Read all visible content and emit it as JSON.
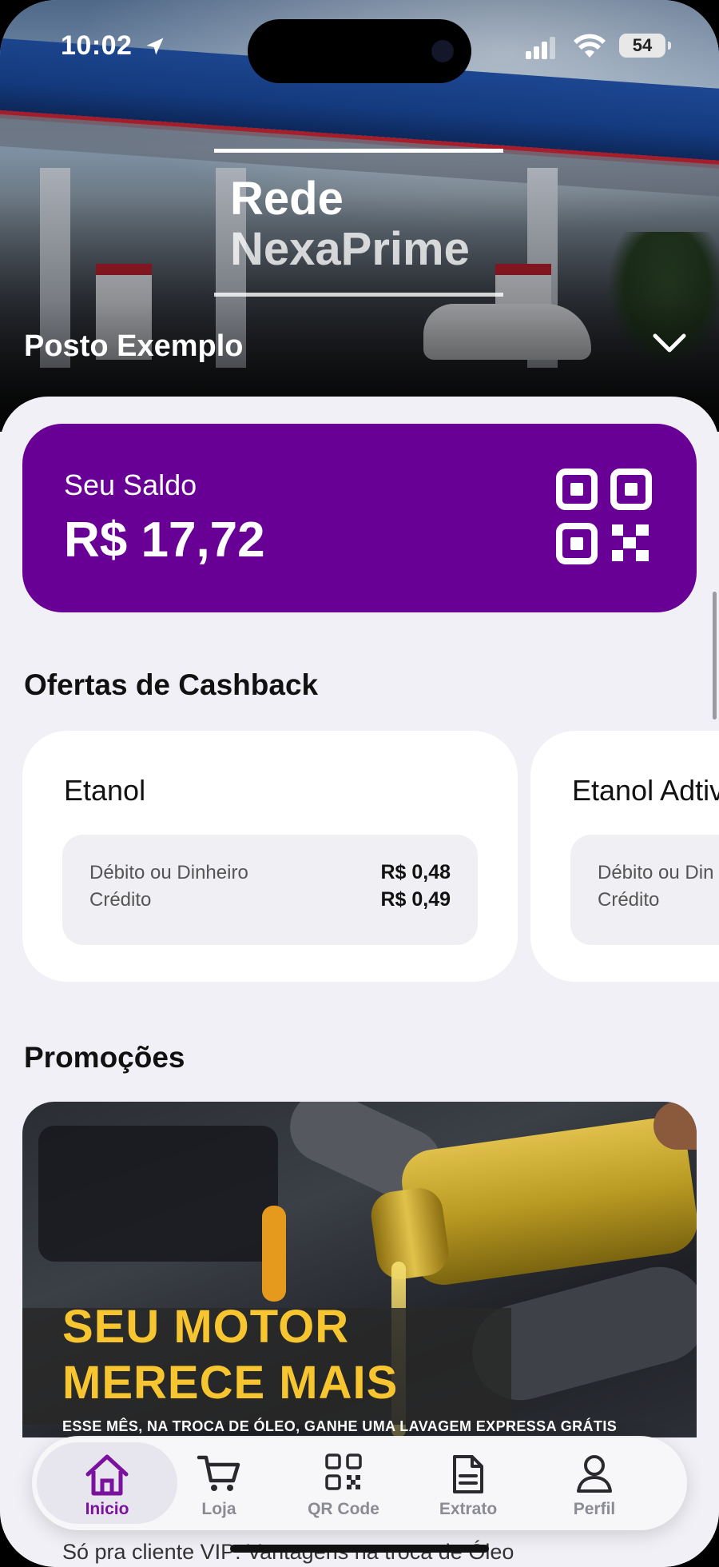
{
  "status_bar": {
    "time": "10:02",
    "battery": "54"
  },
  "brand": {
    "line1": "Rede",
    "line2": "NexaPrime"
  },
  "station": {
    "name": "Posto Exemplo"
  },
  "balance": {
    "label": "Seu Saldo",
    "value": "R$ 17,72"
  },
  "cashback": {
    "title": "Ofertas de Cashback",
    "offers": [
      {
        "name": "Etanol",
        "row1_label": "Débito ou Dinheiro",
        "row1_value": "R$ 0,48",
        "row2_label": "Crédito",
        "row2_value": "R$ 0,49"
      },
      {
        "name": "Etanol Adtiv",
        "row1_label": "Débito ou Din",
        "row2_label": "Crédito"
      }
    ]
  },
  "promotions": {
    "title": "Promoções",
    "banner": {
      "headline1": "SEU MOTOR",
      "headline2": "MERECE MAIS",
      "subtitle": "ESSE MÊS, NA TROCA DE ÓLEO,  GANHE UMA LAVAGEM EXPRESSA GRÁTIS"
    },
    "next_item_subtitle": "Só pra cliente VIP: Vantagens na troca de Óleo"
  },
  "tabbar": {
    "tabs": [
      {
        "label": "Inicio",
        "icon": "home-icon",
        "active": true
      },
      {
        "label": "Loja",
        "icon": "cart-icon"
      },
      {
        "label": "QR Code",
        "icon": "qr-code-icon"
      },
      {
        "label": "Extrato",
        "icon": "document-icon"
      },
      {
        "label": "Perfil",
        "icon": "user-icon"
      }
    ]
  },
  "colors": {
    "primary": "#690096",
    "active_tab": "#7b119f",
    "background": "#f1f0f6",
    "promo_text": "#f7c52f"
  }
}
